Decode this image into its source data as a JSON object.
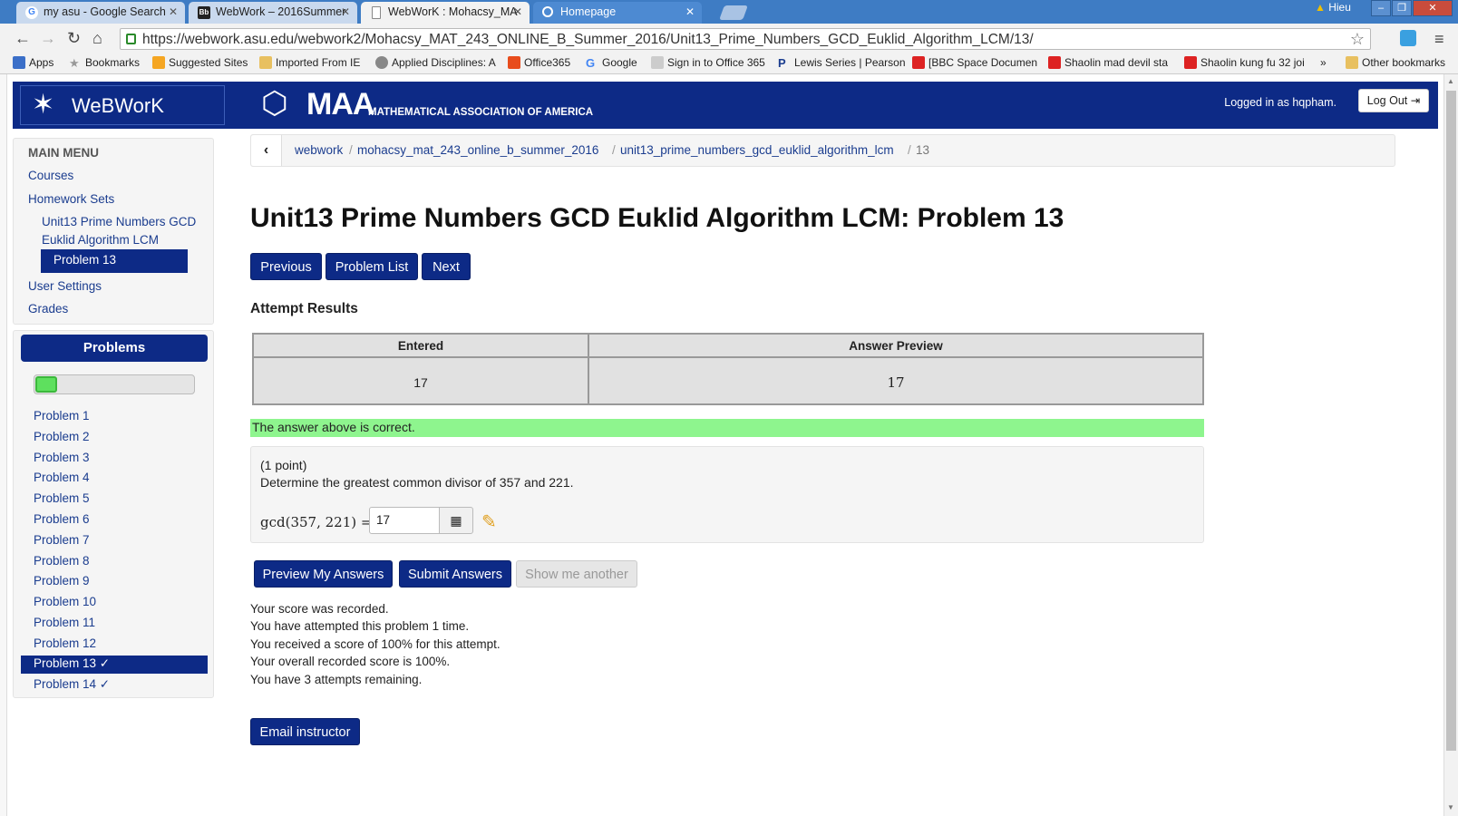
{
  "browser": {
    "tabs": [
      {
        "title": "my asu - Google Search",
        "favicon": "G"
      },
      {
        "title": "WebWork – 2016Summer",
        "favicon": "Bb"
      },
      {
        "title": "WebWorK : Mohacsy_MA",
        "favicon": "D"
      },
      {
        "title": "Homepage",
        "favicon": "O"
      }
    ],
    "user_chip": "Hieu",
    "url": "https://webwork.asu.edu/webwork2/Mohacsy_MAT_243_ONLINE_B_Summer_2016/Unit13_Prime_Numbers_GCD_Euklid_Algorithm_LCM/13/",
    "bookmarks": [
      "Apps",
      "Bookmarks",
      "Suggested Sites",
      "Imported From IE",
      "Applied Disciplines: A",
      "Office365",
      "Google",
      "Sign in to Office 365",
      "Lewis Series | Pearson",
      "[BBC Space Documen",
      "Shaolin mad devil sta",
      "Shaolin kung fu 32 joi",
      "»",
      "Other bookmarks"
    ]
  },
  "header": {
    "brand": "WeBWorK",
    "maa_logo": "MAA",
    "maa_name": "MATHEMATICAL ASSOCIATION OF AMERICA",
    "logged_in": "Logged in as hqpham.",
    "logout": "Log Out"
  },
  "main_menu": {
    "heading": "MAIN MENU",
    "courses": "Courses",
    "homework_sets": "Homework Sets",
    "set_line1": "Unit13 Prime Numbers GCD",
    "set_line2": "Euklid Algorithm LCM",
    "current": "Problem 13",
    "user_settings": "User Settings",
    "grades": "Grades"
  },
  "problems_panel": {
    "heading": "Problems",
    "progress_fraction": 0.14,
    "items": [
      "Problem 1",
      "Problem 2",
      "Problem 3",
      "Problem 4",
      "Problem 5",
      "Problem 6",
      "Problem 7",
      "Problem 8",
      "Problem 9",
      "Problem 10",
      "Problem 11",
      "Problem 12",
      "Problem 13 ✓",
      "Problem 14 ✓"
    ],
    "active_index": 12
  },
  "breadcrumb": {
    "back": "‹",
    "items": [
      "webwork",
      "mohacsy_mat_243_online_b_summer_2016",
      "unit13_prime_numbers_gcd_euklid_algorithm_lcm",
      "13"
    ],
    "sep": "/"
  },
  "title": "Unit13 Prime Numbers GCD Euklid Algorithm LCM: Problem 13",
  "nav_buttons": {
    "previous": "Previous",
    "problem_list": "Problem List",
    "next": "Next"
  },
  "attempt": {
    "heading": "Attempt Results",
    "col_entered": "Entered",
    "col_preview": "Answer Preview",
    "entered": "17",
    "preview": "17",
    "status": "The answer above is correct."
  },
  "problem": {
    "points": "(1 point)",
    "question": "Determine the greatest common divisor of 357 and 221.",
    "formula": "gcd(357, 221) =",
    "answer_value": "17"
  },
  "actions": {
    "preview": "Preview My Answers",
    "submit": "Submit Answers",
    "another": "Show me another"
  },
  "messages": [
    "Your score was recorded.",
    "You have attempted this problem 1 time.",
    "You received a score of 100% for this attempt.",
    "Your overall recorded score is 100%.",
    "You have 3 attempts remaining."
  ],
  "email": "Email instructor",
  "colors": {
    "navy": "#0d2a86",
    "correct_green": "#8ef58e",
    "chrome_blue": "#3e7cc4"
  }
}
